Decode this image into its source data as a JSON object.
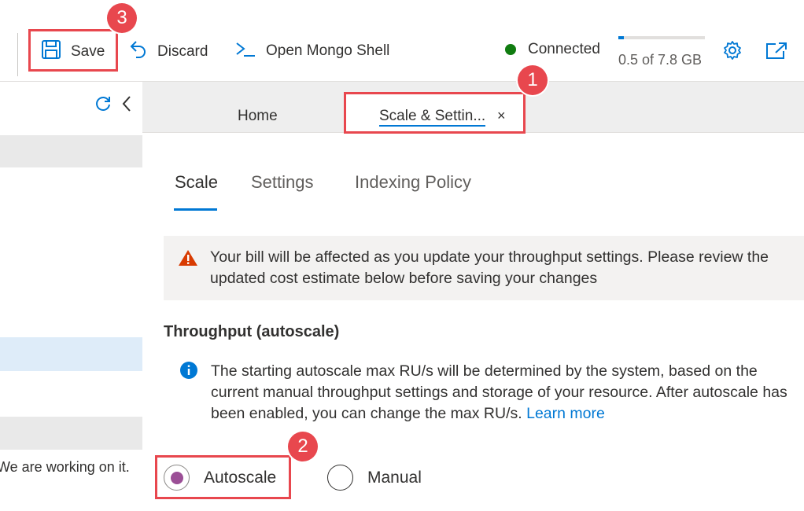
{
  "toolbar": {
    "save_label": "Save",
    "discard_label": "Discard",
    "mongo_shell_label": "Open Mongo Shell",
    "connection_status": "Connected",
    "storage_text": "0.5 of 7.8 GB",
    "storage_fraction": 0.064
  },
  "left_panel": {
    "status_message": "We are working on it."
  },
  "tabs": {
    "home_label": "Home",
    "active_label": "Scale & Settin...",
    "close_glyph": "×"
  },
  "subtabs": [
    "Scale",
    "Settings",
    "Indexing Policy"
  ],
  "warning": {
    "text": "Your bill will be affected as you update your throughput settings. Please review the updated cost estimate below before saving your changes"
  },
  "throughput": {
    "title": "Throughput (autoscale)",
    "info_text": "The starting autoscale max RU/s will be determined by the system, based on the current manual throughput settings and storage of your resource. After autoscale has been enabled, you can change the max RU/s.",
    "learn_more": "Learn more",
    "options": [
      "Autoscale",
      "Manual"
    ],
    "selected": "Autoscale"
  },
  "callouts": [
    "1",
    "2",
    "3"
  ],
  "colors": {
    "accent": "#0078d4",
    "connected": "#107c10",
    "warning": "#d83b01",
    "callout": "#e8474e",
    "radio_selected": "#9b4f96"
  },
  "icons": {
    "save": "save-icon",
    "discard": "undo-icon",
    "mongo": "terminal-icon",
    "settings": "gear-icon",
    "popout": "open-in-new-icon",
    "refresh": "refresh-icon",
    "collapse": "chevron-left-icon",
    "warning": "warning-icon",
    "info": "info-icon"
  }
}
